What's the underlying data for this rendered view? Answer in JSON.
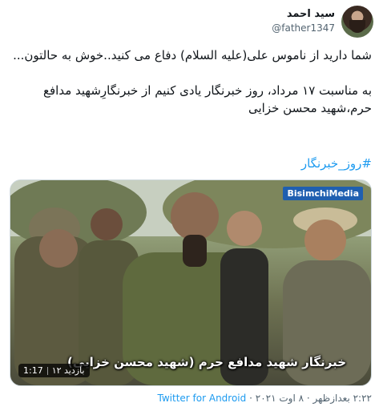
{
  "author": {
    "name": "سید احمد",
    "handle": "@father1347"
  },
  "tweet": {
    "paragraph1": "شما دارید از ناموس علی(علیه السلام) دفاع می کنید..خوش به حالتون...",
    "paragraph2": "به مناسبت ۱۷ مرداد، روز خبرنگار یادی کنیم از خبرنگارِشهید مدافع حرم،شهید محسن خزایی",
    "hashtag": "#روز_خبرنگار"
  },
  "video": {
    "watermark": "BisimchiMedia",
    "caption": "خبرنگار شهید مدافع حرم (شهید محسن خزایی)",
    "duration": "1:17",
    "views": "۱۲ بازدید"
  },
  "meta": {
    "time": "۲:۲۲ بعدازظهر",
    "date": "۸ اوت ۲۰۲۱",
    "separator": "·",
    "source": "Twitter for Android"
  },
  "colors": {
    "link": "#1d9bf0",
    "secondary": "#536471",
    "text": "#0f1419"
  }
}
